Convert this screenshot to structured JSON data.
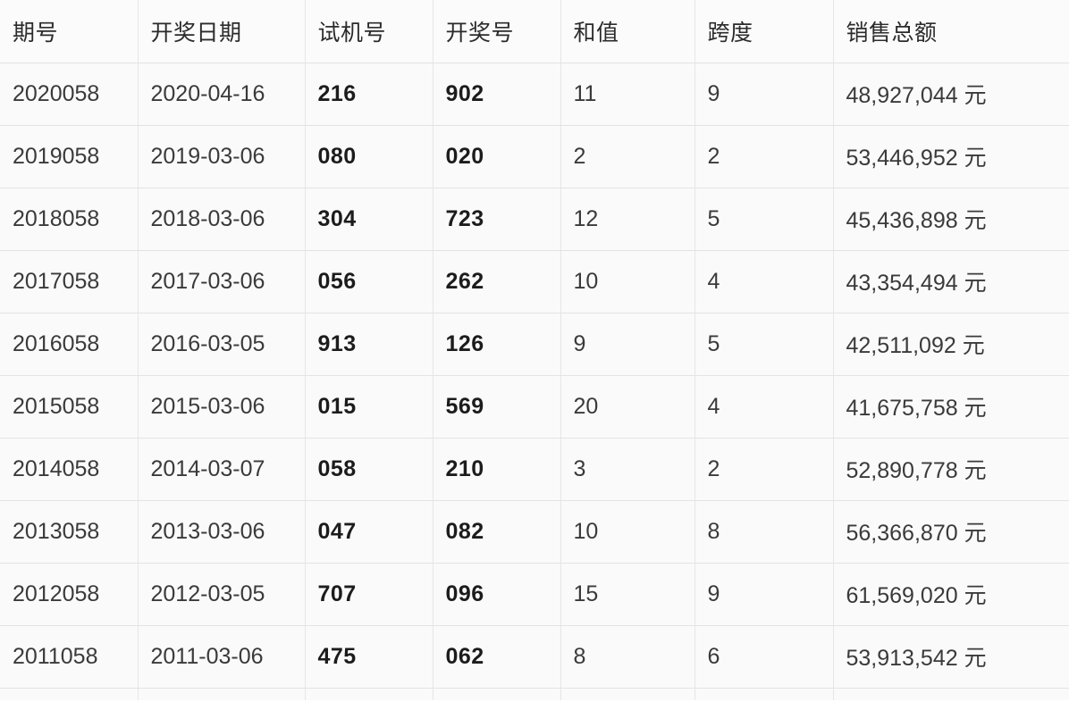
{
  "table": {
    "name": "lottery-draw-history",
    "columns": [
      {
        "key": "issue",
        "label": "期号"
      },
      {
        "key": "date",
        "label": "开奖日期"
      },
      {
        "key": "test",
        "label": "试机号"
      },
      {
        "key": "draw",
        "label": "开奖号"
      },
      {
        "key": "sum",
        "label": "和值"
      },
      {
        "key": "span",
        "label": "跨度"
      },
      {
        "key": "sales",
        "label": "销售总额"
      }
    ],
    "rows": [
      {
        "issue": "2020058",
        "date": "2020-04-16",
        "test": "216",
        "draw": "902",
        "sum": "11",
        "span": "9",
        "sales": "48,927,044 元"
      },
      {
        "issue": "2019058",
        "date": "2019-03-06",
        "test": "080",
        "draw": "020",
        "sum": "2",
        "span": "2",
        "sales": "53,446,952 元"
      },
      {
        "issue": "2018058",
        "date": "2018-03-06",
        "test": "304",
        "draw": "723",
        "sum": "12",
        "span": "5",
        "sales": "45,436,898 元"
      },
      {
        "issue": "2017058",
        "date": "2017-03-06",
        "test": "056",
        "draw": "262",
        "sum": "10",
        "span": "4",
        "sales": "43,354,494 元"
      },
      {
        "issue": "2016058",
        "date": "2016-03-05",
        "test": "913",
        "draw": "126",
        "sum": "9",
        "span": "5",
        "sales": "42,511,092 元"
      },
      {
        "issue": "2015058",
        "date": "2015-03-06",
        "test": "015",
        "draw": "569",
        "sum": "20",
        "span": "4",
        "sales": "41,675,758 元"
      },
      {
        "issue": "2014058",
        "date": "2014-03-07",
        "test": "058",
        "draw": "210",
        "sum": "3",
        "span": "2",
        "sales": "52,890,778 元"
      },
      {
        "issue": "2013058",
        "date": "2013-03-06",
        "test": "047",
        "draw": "082",
        "sum": "10",
        "span": "8",
        "sales": "56,366,870 元"
      },
      {
        "issue": "2012058",
        "date": "2012-03-05",
        "test": "707",
        "draw": "096",
        "sum": "15",
        "span": "9",
        "sales": "61,569,020 元"
      },
      {
        "issue": "2011058",
        "date": "2011-03-06",
        "test": "475",
        "draw": "062",
        "sum": "8",
        "span": "6",
        "sales": "53,913,542 元"
      }
    ]
  },
  "colors": {
    "cell_background": "#fafafa",
    "header_background": "#fbfbfb",
    "grid_line": "#e6e6e8",
    "text": "#3a3a3a",
    "emphasis_text": "#1c1c1c"
  }
}
